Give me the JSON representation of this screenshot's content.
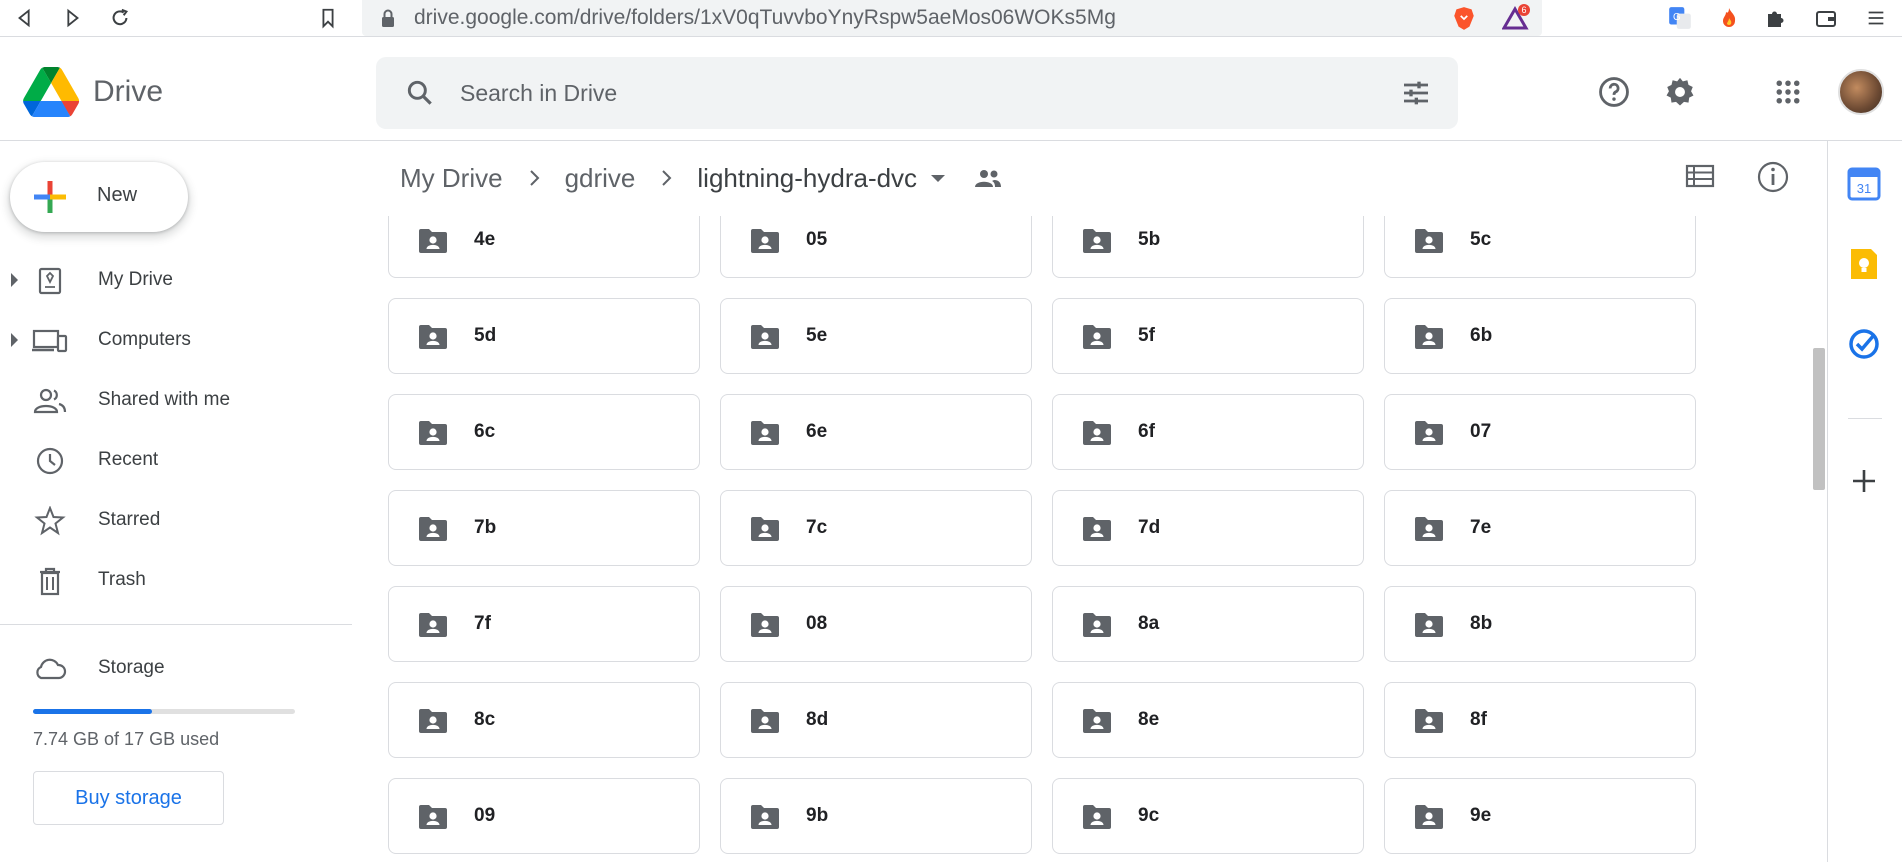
{
  "browser": {
    "url": "drive.google.com/drive/folders/1xV0qTuvvboYnyRspw5aeMos06WOKs5Mg",
    "extension_badge": "6"
  },
  "header": {
    "app_name": "Drive",
    "search_placeholder": "Search in Drive"
  },
  "sidebar": {
    "new_label": "New",
    "items": [
      {
        "label": "My Drive",
        "icon": "my-drive-icon"
      },
      {
        "label": "Computers",
        "icon": "computers-icon"
      },
      {
        "label": "Shared with me",
        "icon": "people-icon"
      },
      {
        "label": "Recent",
        "icon": "clock-icon"
      },
      {
        "label": "Starred",
        "icon": "star-icon"
      },
      {
        "label": "Trash",
        "icon": "trash-icon"
      }
    ],
    "storage": {
      "label": "Storage",
      "used_text": "7.74 GB of 17 GB used",
      "used_fraction": 0.455,
      "buy_label": "Buy storage"
    }
  },
  "breadcrumb": {
    "items": [
      "My Drive",
      "gdrive",
      "lightning-hydra-dvc"
    ]
  },
  "folders": [
    "4e",
    "05",
    "5b",
    "5c",
    "5d",
    "5e",
    "5f",
    "6b",
    "6c",
    "6e",
    "6f",
    "07",
    "7b",
    "7c",
    "7d",
    "7e",
    "7f",
    "08",
    "8a",
    "8b",
    "8c",
    "8d",
    "8e",
    "8f",
    "09",
    "9b",
    "9c",
    "9e"
  ],
  "side_panel": {
    "calendar_day": "31"
  },
  "colors": {
    "accent": "#1a73e8",
    "icon_gray": "#5f6368"
  }
}
